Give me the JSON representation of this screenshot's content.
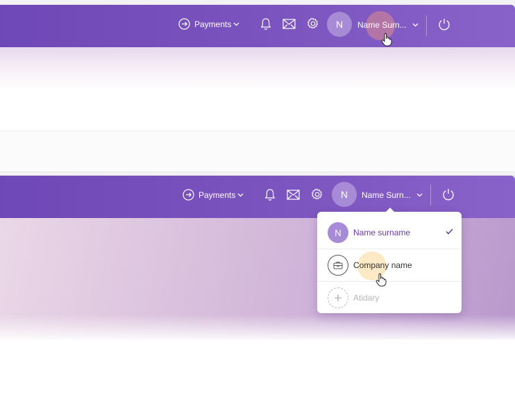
{
  "screen_before": {
    "nav": {
      "payments_label": "Payments",
      "user_initial": "N",
      "user_name": "Name Surn..."
    }
  },
  "screen_after": {
    "nav": {
      "payments_label": "Payments",
      "user_initial": "N",
      "user_name": "Name Surn..."
    },
    "account_menu": {
      "items": [
        {
          "initial": "N",
          "label": "Name surname",
          "selected": true
        },
        {
          "icon": "briefcase-icon",
          "label": "Company name"
        },
        {
          "icon": "plus-icon",
          "label": "Atidary"
        }
      ]
    }
  },
  "colors": {
    "brand_purple": "#7a53be",
    "avatar_purple": "#a88bd6",
    "selected_text": "#6a3aa3"
  }
}
